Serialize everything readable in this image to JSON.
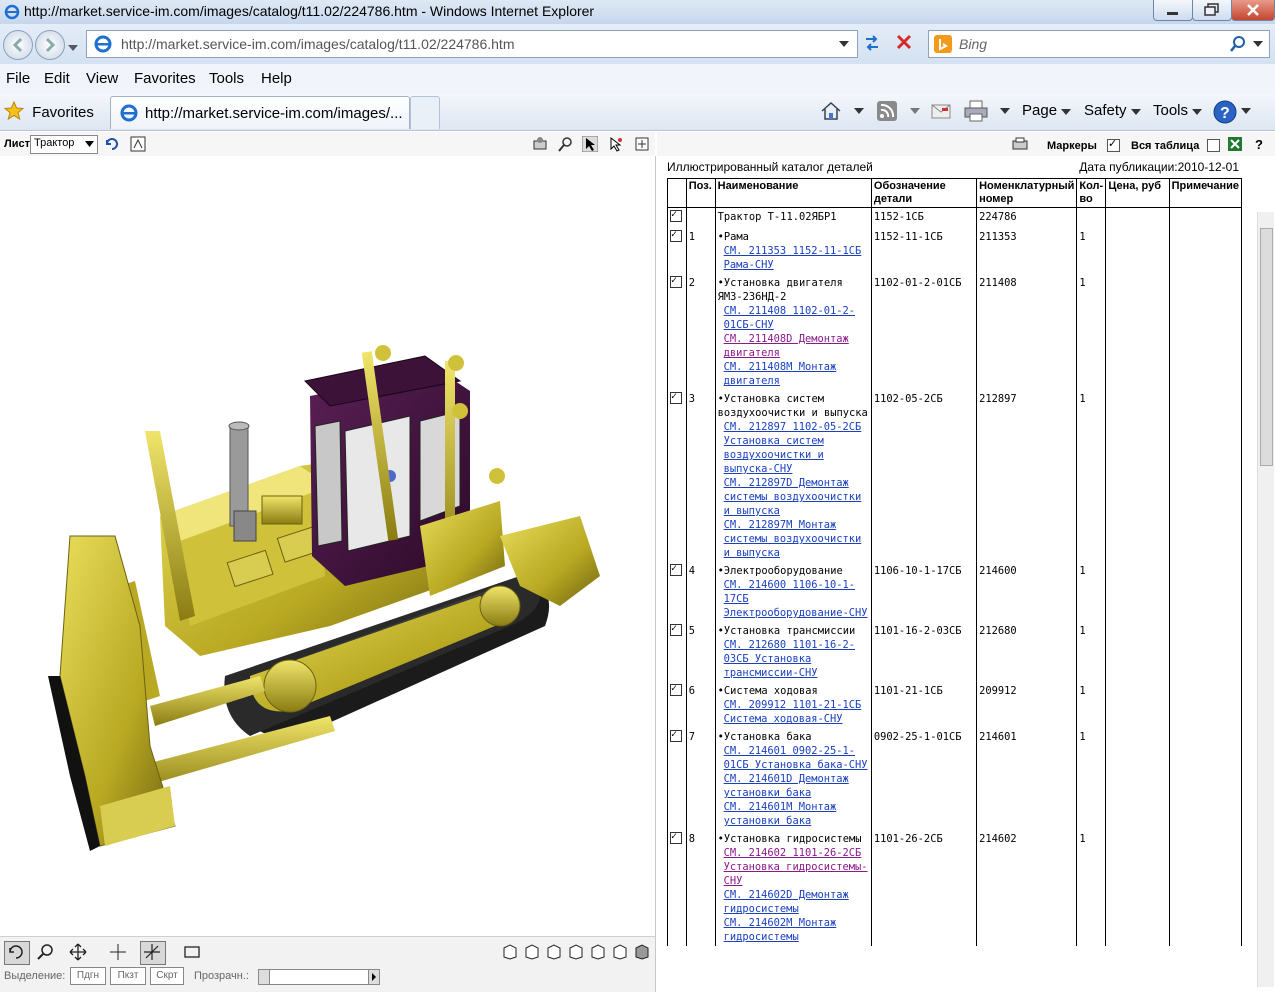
{
  "window": {
    "title": "http://market.service-im.com/images/catalog/t11.02/224786.htm - Windows Internet Explorer"
  },
  "address": {
    "url": "http://market.service-im.com/images/catalog/t11.02/224786.htm"
  },
  "search": {
    "placeholder": "Bing"
  },
  "menu": [
    "File",
    "Edit",
    "View",
    "Favorites",
    "Tools",
    "Help"
  ],
  "favbar": {
    "favorites": "Favorites",
    "tab_title": "http://market.service-im.com/images/...",
    "page": "Page",
    "safety": "Safety",
    "tools": "Tools"
  },
  "viewer": {
    "sheet_label": "Лист",
    "sheet_value": "Трактор",
    "bottom": {
      "selection": "Выделение:",
      "btn1": "Пдгн",
      "btn2": "Пкзт",
      "btn3": "Скрт",
      "transparency": "Прозрачн.:"
    }
  },
  "righttool": {
    "markers": "Маркеры",
    "all_table": "Вся таблица",
    "help": "?"
  },
  "catalog": {
    "heading": "Иллюстрированный каталог деталей",
    "date": "Дата публикации:2010-12-01",
    "columns": [
      "Поз.",
      "Наименование",
      "Обозначение детали",
      "Номенклатурный номер",
      "Кол-во",
      "Цена, руб",
      "Примечание"
    ],
    "rows": [
      {
        "pos": "",
        "name": "Трактор Т-11.02ЯБР1",
        "links": [],
        "designation": "1152-1СБ",
        "number": "224786",
        "qty": ""
      },
      {
        "pos": "1",
        "name": "•Рама",
        "links": [
          "СМ. 211353 1152-11-1СБ Рама-СНУ"
        ],
        "designation": "1152-11-1СБ",
        "number": "211353",
        "qty": "1"
      },
      {
        "pos": "2",
        "name": "•Установка двигателя ЯМЗ-236НД-2",
        "links": [
          "СМ. 211408 1102-01-2-01СБ-СНУ",
          "СМ. 211408D Демонтаж двигателя",
          "СМ. 211408M Монтаж двигателя"
        ],
        "designation": "1102-01-2-01СБ",
        "number": "211408",
        "qty": "1"
      },
      {
        "pos": "3",
        "name": "•Установка систем воздухоочистки и выпуска",
        "links": [
          "СМ. 212897 1102-05-2СБ Установка систем воздухоочистки и выпуска-СНУ",
          "СМ. 212897D Демонтаж системы воздухоочистки и выпуска",
          "СМ. 212897M Монтаж системы воздухоочистки и выпуска"
        ],
        "designation": "1102-05-2СБ",
        "number": "212897",
        "qty": "1"
      },
      {
        "pos": "4",
        "name": "•Электрооборудование",
        "links": [
          "СМ. 214600 1106-10-1-17СБ Электрооборудование-СНУ"
        ],
        "designation": "1106-10-1-17СБ",
        "number": "214600",
        "qty": "1"
      },
      {
        "pos": "5",
        "name": "•Установка трансмиссии",
        "links": [
          "СМ. 212680 1101-16-2-03СБ Установка трансмиссии-СНУ"
        ],
        "designation": "1101-16-2-03СБ",
        "number": "212680",
        "qty": "1"
      },
      {
        "pos": "6",
        "name": "•Система ходовая",
        "links": [
          "СМ. 209912 1101-21-1СБ Система ходовая-СНУ"
        ],
        "designation": "1101-21-1СБ",
        "number": "209912",
        "qty": "1"
      },
      {
        "pos": "7",
        "name": "•Установка бака",
        "links": [
          "СМ. 214601 0902-25-1-01СБ Установка бака-СНУ",
          "СМ. 214601D Демонтаж установки бака",
          "СМ. 214601M Монтаж установки бака"
        ],
        "designation": "0902-25-1-01СБ",
        "number": "214601",
        "qty": "1"
      },
      {
        "pos": "8",
        "name": "•Установка гидросистемы",
        "links": [
          "СМ. 214602 1101-26-2СБ Установка гидросистемы-СНУ",
          "СМ. 214602D Демонтаж гидросистемы",
          "СМ. 214602M Монтаж гидросистемы"
        ],
        "designation": "1101-26-2СБ",
        "number": "214602",
        "qty": "1"
      }
    ]
  }
}
